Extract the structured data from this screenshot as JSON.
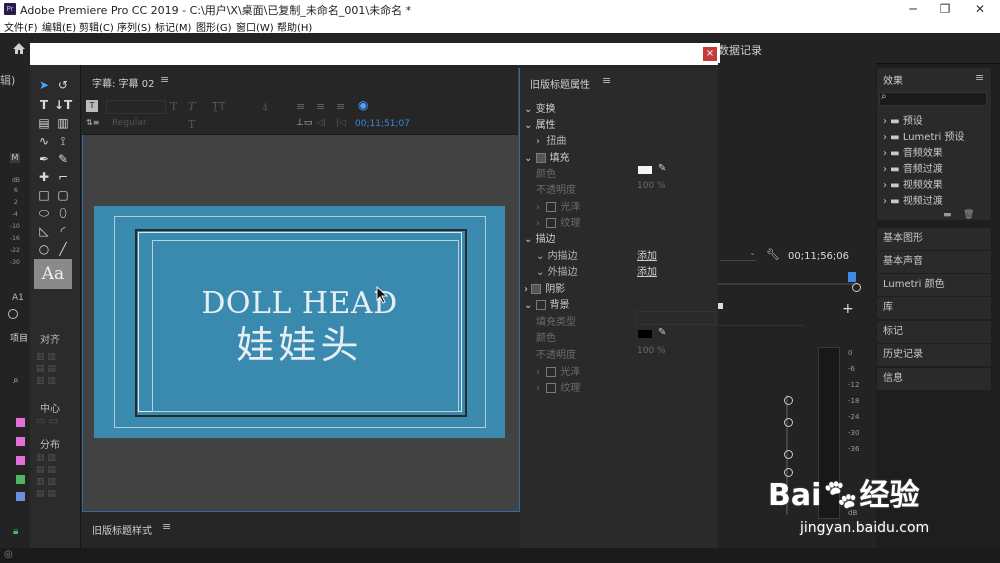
{
  "window": {
    "title": "Adobe Premiere Pro CC 2019 - C:\\用户\\X\\桌面\\已复制_未命名_001\\未命名 *",
    "app_icon_label": "Pr",
    "minimize": "─",
    "maximize": "❐",
    "close": "✕"
  },
  "menu": [
    "文件(F)",
    "编辑(E)",
    "剪辑(C)",
    "序列(S)",
    "标记(M)",
    "图形(G)",
    "窗口(W)",
    "帮助(H)"
  ],
  "workspace": {
    "visible_tab": "数据记录",
    "home_icon": "home-icon"
  },
  "left_strip": {
    "label_top": "辑)",
    "label_a1": "A1",
    "db_ticks": [
      "dB",
      "6",
      "2",
      "-4",
      "-10",
      "-16",
      "-22",
      "-30",
      "-40"
    ],
    "panel_item": "项目",
    "link_icon": "link-icon"
  },
  "dialog": {
    "close_label": "×"
  },
  "titler": {
    "panel_title": "字幕: 字幕 02",
    "font_style": "Regular",
    "timecode": "00;11;51;07",
    "canvas": {
      "line1": "DOLL HEAD",
      "line2": "娃娃头",
      "bg_color": "#3a8ab0"
    },
    "styles_panel_title": "旧版标题样式"
  },
  "align_panel": {
    "title": "对齐",
    "center": "中心",
    "distribute": "分布"
  },
  "properties": {
    "title": "旧版标题属性",
    "rows": [
      {
        "label": "变换",
        "type": "section"
      },
      {
        "label": "属性",
        "type": "section"
      },
      {
        "label": "扭曲",
        "type": "sub"
      },
      {
        "label": "填充",
        "type": "section-check"
      },
      {
        "label": "颜色",
        "type": "dim"
      },
      {
        "label": "不透明度",
        "type": "dim",
        "value": "100 %"
      },
      {
        "label": "光泽",
        "type": "dim-check"
      },
      {
        "label": "纹理",
        "type": "dim-check"
      },
      {
        "label": "描边",
        "type": "section"
      },
      {
        "label": "内描边",
        "type": "sub",
        "action": "添加"
      },
      {
        "label": "外描边",
        "type": "sub",
        "action": "添加"
      },
      {
        "label": "阴影",
        "type": "section-check"
      },
      {
        "label": "背景",
        "type": "section-check"
      },
      {
        "label": "填充类型",
        "type": "dim"
      },
      {
        "label": "颜色",
        "type": "dim"
      },
      {
        "label": "不透明度",
        "type": "dim",
        "value": "100 %"
      },
      {
        "label": "光泽",
        "type": "dim-check"
      },
      {
        "label": "纹理",
        "type": "dim-check"
      }
    ]
  },
  "effects_panel": {
    "title": "效果",
    "items": [
      "预设",
      "Lumetri 预设",
      "音频效果",
      "音频过渡",
      "视频效果",
      "视频过渡"
    ]
  },
  "right_buttons": [
    "基本图形",
    "基本声音",
    "Lumetri 颜色",
    "库",
    "标记",
    "历史记录",
    "信息"
  ],
  "program": {
    "timecode": "00;11;56;06",
    "plus": "+"
  },
  "meter": {
    "ticks": [
      "0",
      "-6",
      "-12",
      "-18",
      "-24",
      "-30",
      "-36"
    ],
    "db": "dB"
  },
  "watermark": {
    "brand": "Bai",
    "brand2": "经验",
    "url": "jingyan.baidu.com"
  }
}
